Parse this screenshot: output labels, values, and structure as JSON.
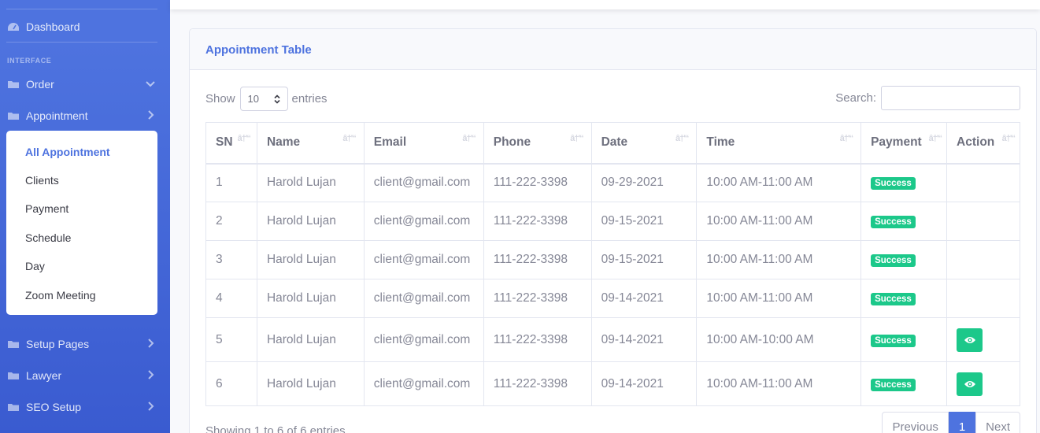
{
  "sidebar": {
    "dashboard": "Dashboard",
    "heading": "INTERFACE",
    "items": {
      "order": "Order",
      "appointment": "Appointment",
      "setup_pages": "Setup Pages",
      "lawyer": "Lawyer",
      "seo_setup": "SEO Setup"
    },
    "submenu": [
      "All Appointment",
      "Clients",
      "Payment",
      "Schedule",
      "Day",
      "Zoom Meeting"
    ],
    "active_submenu": "All Appointment"
  },
  "card": {
    "title": "Appointment Table"
  },
  "length": {
    "show_label": "Show",
    "value": "10",
    "entries_label": "entries"
  },
  "search": {
    "label": "Search:",
    "value": ""
  },
  "table": {
    "columns": [
      "SN",
      "Name",
      "Email",
      "Phone",
      "Date",
      "Time",
      "Payment",
      "Action"
    ],
    "rows": [
      {
        "sn": "1",
        "name": "Harold Lujan",
        "email": "client@gmail.com",
        "phone": "111-222-3398",
        "date": "09-29-2021",
        "time": "10:00 AM-11:00 AM",
        "payment": "Success",
        "action": false
      },
      {
        "sn": "2",
        "name": "Harold Lujan",
        "email": "client@gmail.com",
        "phone": "111-222-3398",
        "date": "09-15-2021",
        "time": "10:00 AM-11:00 AM",
        "payment": "Success",
        "action": false
      },
      {
        "sn": "3",
        "name": "Harold Lujan",
        "email": "client@gmail.com",
        "phone": "111-222-3398",
        "date": "09-15-2021",
        "time": "10:00 AM-11:00 AM",
        "payment": "Success",
        "action": false
      },
      {
        "sn": "4",
        "name": "Harold Lujan",
        "email": "client@gmail.com",
        "phone": "111-222-3398",
        "date": "09-14-2021",
        "time": "10:00 AM-11:00 AM",
        "payment": "Success",
        "action": false
      },
      {
        "sn": "5",
        "name": "Harold Lujan",
        "email": "client@gmail.com",
        "phone": "111-222-3398",
        "date": "09-14-2021",
        "time": "10:00 AM-10:00 AM",
        "payment": "Success",
        "action": true
      },
      {
        "sn": "6",
        "name": "Harold Lujan",
        "email": "client@gmail.com",
        "phone": "111-222-3398",
        "date": "09-14-2021",
        "time": "10:00 AM-11:00 AM",
        "payment": "Success",
        "action": true
      }
    ]
  },
  "footer": {
    "info": "Showing 1 to 6 of 6 entries",
    "previous": "Previous",
    "current_page": "1",
    "next": "Next"
  },
  "colors": {
    "sidebar": "#4e73df",
    "success": "#1cc88a",
    "primary": "#4e73df"
  },
  "icons": [
    "tachometer-icon",
    "folder-icon",
    "chevron-down-icon",
    "chevron-right-icon",
    "eye-icon",
    "sort-icon",
    "select-arrows-icon"
  ]
}
